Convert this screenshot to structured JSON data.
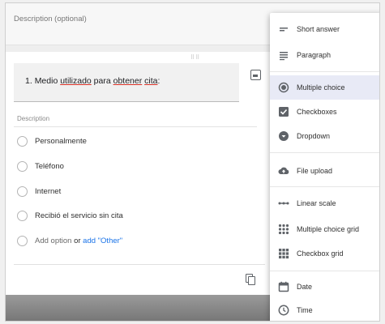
{
  "description_card": {
    "placeholder": "Description (optional)"
  },
  "question": {
    "number": "1.",
    "title_part1": "Medio",
    "title_part2": "utilizado",
    "title_part3": "para",
    "title_part4": "obtener",
    "title_part5": "cita",
    "title_end": ":",
    "description_label": "Description",
    "options": [
      "Personalmente",
      "Teléfono",
      "Internet",
      "Recibió el servicio sin cita"
    ],
    "add_option": "Add option",
    "or": "or",
    "add_other": "add \"Other\""
  },
  "menu": {
    "items": [
      {
        "label": "Short answer",
        "icon": "short-answer-icon"
      },
      {
        "label": "Paragraph",
        "icon": "paragraph-icon"
      },
      {
        "label": "Multiple choice",
        "icon": "radio-icon",
        "selected": true
      },
      {
        "label": "Checkboxes",
        "icon": "checkbox-icon"
      },
      {
        "label": "Dropdown",
        "icon": "dropdown-icon"
      },
      {
        "label": "File upload",
        "icon": "cloud-upload-icon"
      },
      {
        "label": "Linear scale",
        "icon": "linear-scale-icon"
      },
      {
        "label": "Multiple choice grid",
        "icon": "grid-icon"
      },
      {
        "label": "Checkbox grid",
        "icon": "checkbox-grid-icon"
      },
      {
        "label": "Date",
        "icon": "calendar-icon"
      },
      {
        "label": "Time",
        "icon": "clock-icon"
      }
    ]
  },
  "colors": {
    "selected_bg": "#e8eaf6",
    "link": "#1a73e8",
    "icon": "#5f6368"
  }
}
